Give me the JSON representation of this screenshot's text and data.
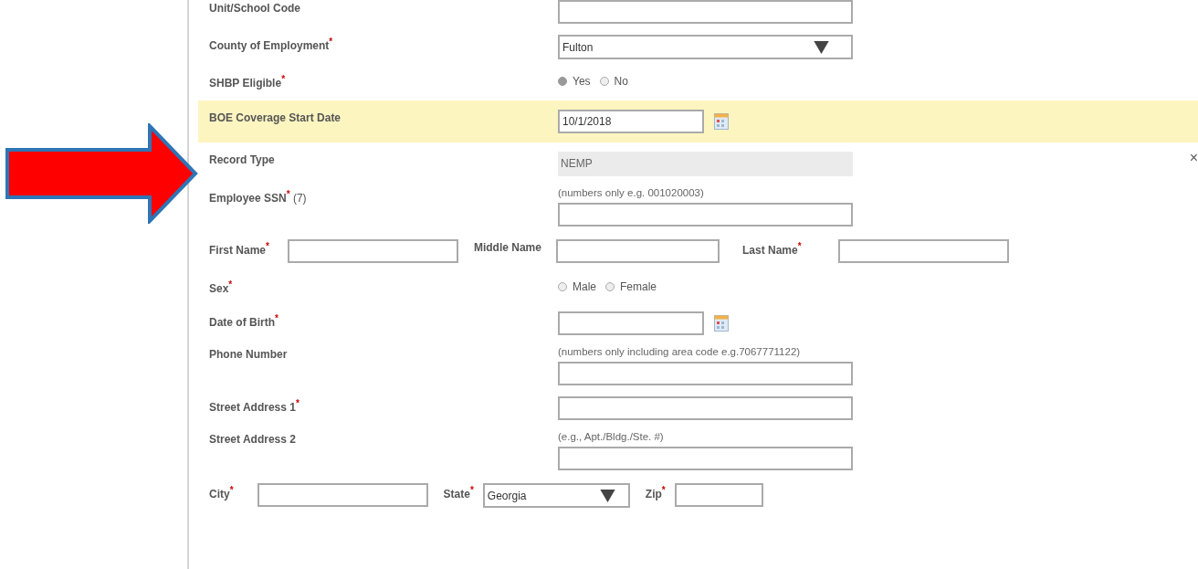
{
  "form": {
    "rows": [
      {
        "kind": "text",
        "label": "Unit/School Code"
      },
      {
        "kind": "select",
        "label": "County of Employment",
        "mark": "*",
        "value": "Fulton"
      },
      {
        "kind": "radio",
        "label": "SHBP Eligible",
        "mark": "*",
        "options": [
          {
            "label": "Yes",
            "selected": true
          },
          {
            "label": "No",
            "selected": false
          }
        ]
      },
      {
        "kind": "date",
        "label": "BOE Coverage Start Date",
        "value": "10/1/2018",
        "highlighted": true
      },
      {
        "kind": "readonly",
        "label": "Record Type",
        "value": "NEMP",
        "dismiss": "×"
      },
      {
        "kind": "text",
        "label": "Employee SSN",
        "mark": "*",
        "note": "(7)",
        "hint": "(numbers only e.g. 001020003)"
      },
      {
        "kind": "inline",
        "fields": [
          {
            "kind": "text",
            "label": "First Name",
            "mark": "*"
          },
          {
            "kind": "text",
            "label": "Middle Name"
          },
          {
            "kind": "text",
            "label": "Last Name",
            "mark": "*"
          }
        ]
      },
      {
        "kind": "radio",
        "label": "Sex",
        "mark": "*",
        "options": [
          {
            "label": "Male",
            "selected": false
          },
          {
            "label": "Female",
            "selected": false
          }
        ]
      },
      {
        "kind": "date",
        "label": "Date of Birth",
        "mark": "*"
      },
      {
        "kind": "text",
        "label": "Phone Number",
        "hint": "(numbers only including area code e.g.7067771122)"
      },
      {
        "kind": "text",
        "label": "Street Address 1",
        "mark": "*"
      },
      {
        "kind": "text",
        "label": "Street Address 2",
        "hint": "(e.g., Apt./Bldg./Ste. #)"
      },
      {
        "kind": "inline",
        "fields": [
          {
            "kind": "text",
            "label": "City",
            "mark": "*"
          },
          {
            "kind": "select",
            "label": "State",
            "mark": "*",
            "value": "Georgia"
          },
          {
            "kind": "text",
            "label": "Zip",
            "mark": "*"
          }
        ]
      }
    ]
  }
}
